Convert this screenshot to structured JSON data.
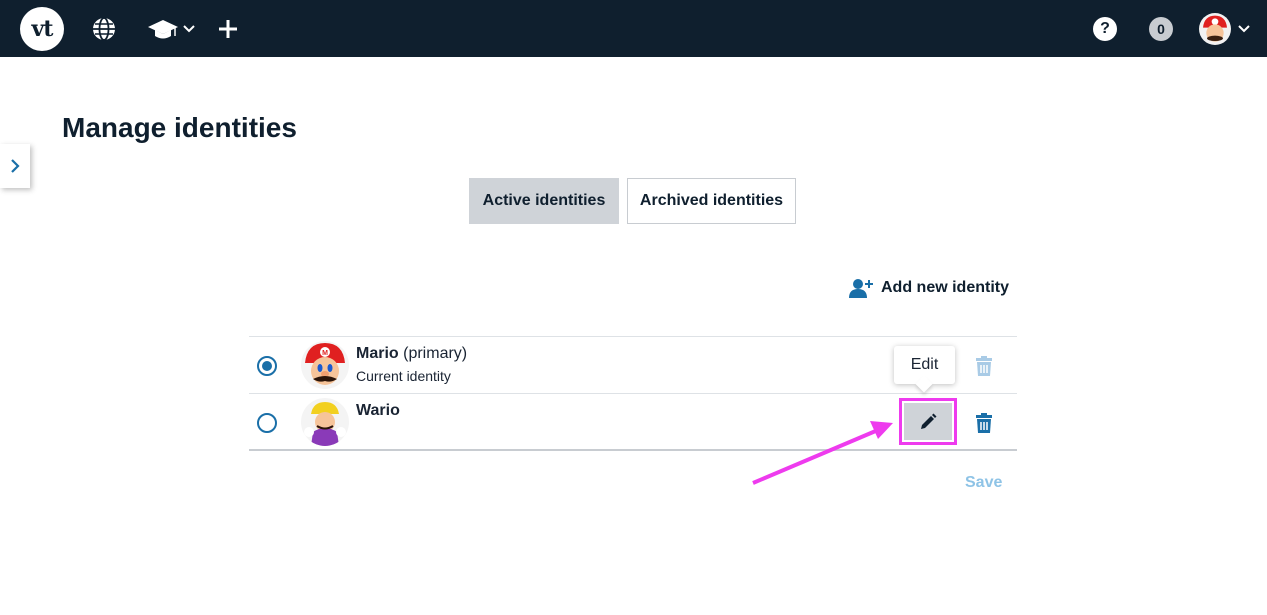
{
  "header": {
    "logo_text": "vt",
    "icons": [
      "globe-icon",
      "graduation-cap-icon",
      "chevron-down-icon",
      "plus-icon",
      "help-icon",
      "avatar",
      "chevron-down-icon"
    ],
    "help_label": "?",
    "notification_count": "0",
    "colors": {
      "background": "#0f1f2e",
      "text": "#ffffff"
    }
  },
  "page": {
    "title": "Manage identities"
  },
  "tabs": [
    {
      "label": "Active identities",
      "active": true
    },
    {
      "label": "Archived identities",
      "active": false
    }
  ],
  "actions": {
    "add_identity_label": "Add new identity",
    "add_identity_icon": "user-plus-icon",
    "save_label": "Save"
  },
  "identities": [
    {
      "name": "Mario",
      "tag": "(primary)",
      "subtitle": "Current identity",
      "selected": true,
      "avatar": "mario-avatar"
    },
    {
      "name": "Wario",
      "tag": "",
      "subtitle": "",
      "selected": false,
      "avatar": "wario-avatar"
    }
  ],
  "tooltip": {
    "label": "Edit"
  },
  "colors": {
    "accent": "#1a6fa8",
    "highlight": "#ee3bee",
    "save_disabled": "#8ec3e6",
    "tab_active_bg": "#cfd3d8"
  }
}
